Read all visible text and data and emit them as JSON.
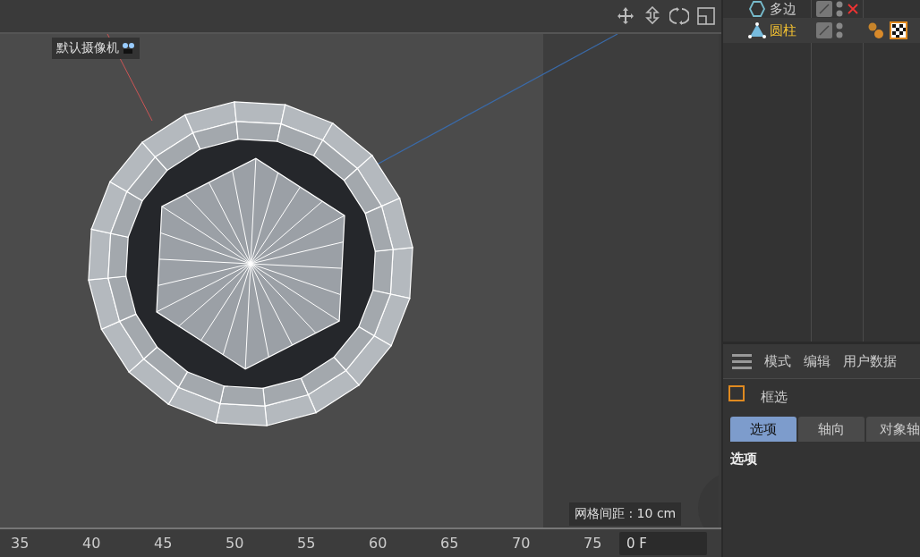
{
  "viewport": {
    "camera_label": "默认摄像机",
    "grid_spacing": "网格间距 : 10 cm"
  },
  "object_manager": {
    "objects": [
      {
        "name": "多边",
        "kind": "polygon",
        "selected": false,
        "enabled": false,
        "material": false
      },
      {
        "name": "圆柱",
        "kind": "cylinder",
        "selected": true,
        "enabled": true,
        "material": true
      }
    ]
  },
  "attributes": {
    "menu": [
      "模式",
      "编辑",
      "用户数据"
    ],
    "tool": {
      "label": "框选",
      "checked": false
    },
    "tabs": [
      {
        "label": "选项",
        "selected": true
      },
      {
        "label": "轴向",
        "selected": false
      },
      {
        "label": "对象轴",
        "selected": false
      }
    ],
    "section": "选项"
  },
  "timeline": {
    "ticks": [
      "35",
      "40",
      "45",
      "50",
      "55",
      "60",
      "65",
      "70",
      "75"
    ],
    "frame": "0 F"
  }
}
